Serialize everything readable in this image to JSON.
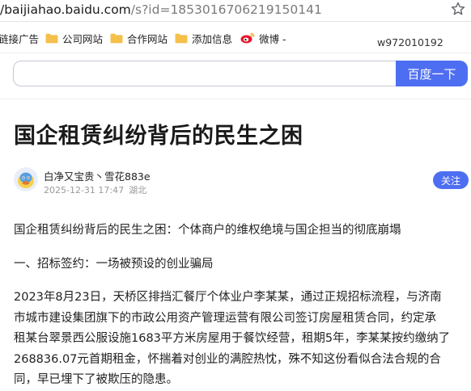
{
  "browser": {
    "url_host": "/baijiahao.baidu.com",
    "url_path": "/s?id=1853016706219150141"
  },
  "bookmarks": {
    "items": [
      {
        "label": "链接广告"
      },
      {
        "label": "公司网站"
      },
      {
        "label": "合作网站"
      },
      {
        "label": "添加信息"
      },
      {
        "label": "微博 -"
      }
    ],
    "user": "w972010192"
  },
  "search": {
    "placeholder": "",
    "button_label": "百度一下"
  },
  "article": {
    "title": "国企租赁纠纷背后的民生之困",
    "author": "白净又宝贵丶雪花883e",
    "date": "2025-12-31 17:47",
    "location": "湖北",
    "follow_label": "关注",
    "paragraphs": [
      "国企租赁纠纷背后的民生之困：个体商户的维权绝境与国企担当的彻底崩塌",
      "一、招标签约：一场被预设的创业骗局",
      "2023年8月23日，天桥区排挡汇餐厅个体业户李某某，通过正规招标流程，与济南市城市建设集团旗下的市政公用资产管理运营有限公司签订房屋租赁合同，约定承租某台翠景西公服设施1683平方米房屋用于餐饮经营，租期5年，李某某按约缴纳了268836.07元首期租金，怀揣着对创业的满腔热忱，殊不知这份看似合法合规的合同，早已埋下了被欺压的隐患。"
    ],
    "p3_lines": [
      "2023年8月23日，天桥区排挡汇餐厅个体业户李某某，通过正规招标流程，与济南",
      "市城市建设集团旗下的市政公用资产管理运营有限公司签订房屋租赁合同，约定承",
      "租某台翠景西公服设施1683平方米房屋用于餐饮经营，租期5年，李某某按约缴纳了",
      "268836.07元首期租金，怀揣着对创业的满腔热忱，殊不知这份看似合法合规的合",
      "同，早已埋下了被欺压的隐患。"
    ]
  },
  "colors": {
    "accent": "#4e6ef2",
    "folder": "#f5c04a"
  },
  "icons": [
    "star-icon",
    "folder-icon",
    "weibo-icon",
    "avatar-icon"
  ]
}
